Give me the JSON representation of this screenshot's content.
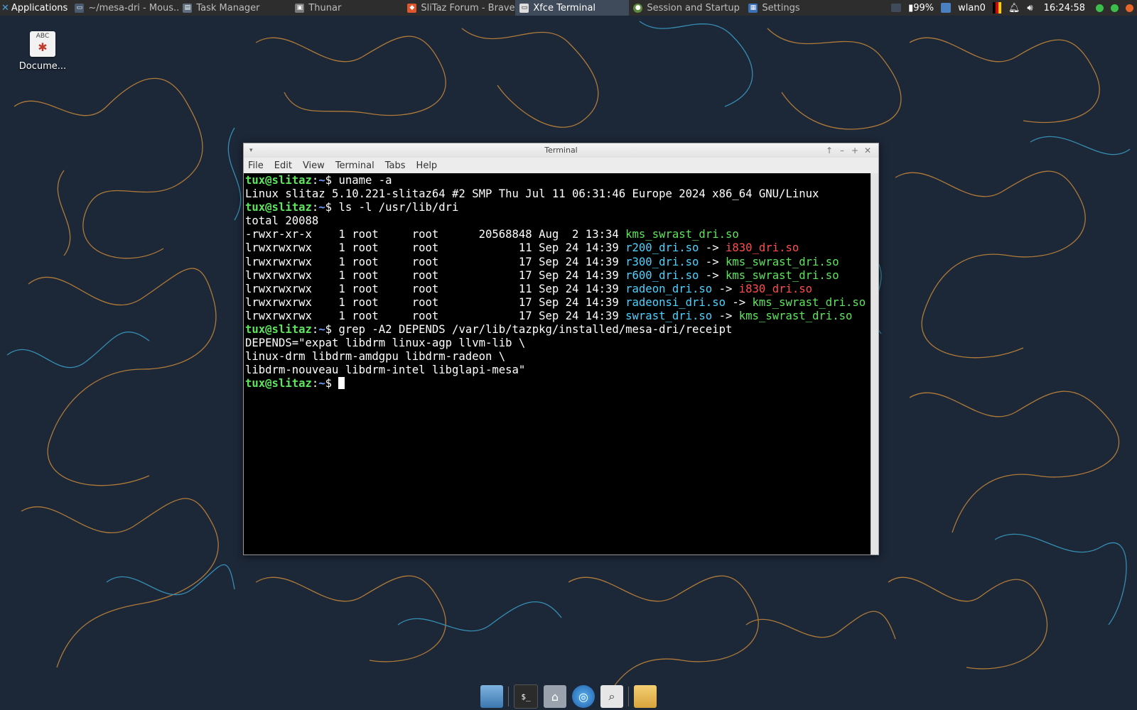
{
  "colors": {
    "panel_bg": "#2d2d2d",
    "terminal_bg": "#000000",
    "prompt_user": "#5ce65c",
    "prompt_dir": "#6b9bff",
    "exec_file": "#5ce65c",
    "symlink": "#4dd2ff",
    "broken_link": "#ff4d4d"
  },
  "top_panel": {
    "applications_label": "Applications",
    "tasks": [
      {
        "label": "~/mesa-dri - Mous...",
        "icon": "terminal-icon",
        "active": false
      },
      {
        "label": "Task Manager",
        "icon": "task-manager-icon",
        "active": false
      },
      {
        "label": "Thunar",
        "icon": "thunar-icon",
        "active": false
      },
      {
        "label": "SliTaz Forum - Brave",
        "icon": "brave-icon",
        "active": false
      },
      {
        "label": "Xfce Terminal",
        "icon": "xfce-terminal-icon",
        "active": true
      },
      {
        "label": "Session and Startup",
        "icon": "session-icon",
        "active": false
      },
      {
        "label": "Settings",
        "icon": "settings-icon",
        "active": false
      }
    ],
    "tray": {
      "battery": "99%",
      "network": "wlan0",
      "clock": "16:24:58"
    }
  },
  "desktop_icon": {
    "label": "Docume..."
  },
  "terminal": {
    "window_title": "Terminal",
    "menu": [
      "File",
      "Edit",
      "View",
      "Terminal",
      "Tabs",
      "Help"
    ],
    "prompt": {
      "user_host": "tux@slitaz",
      "colon": ":",
      "dir": "~",
      "symbol": "$ "
    },
    "lines": [
      {
        "type": "cmd",
        "text": "uname -a"
      },
      {
        "type": "out",
        "text": "Linux slitaz 5.10.221-slitaz64 #2 SMP Thu Jul 11 06:31:46 Europe 2024 x86_64 GNU/Linux"
      },
      {
        "type": "cmd",
        "text": "ls -l /usr/lib/dri"
      },
      {
        "type": "out",
        "text": "total 20088"
      },
      {
        "type": "ls",
        "meta": "-rwxr-xr-x    1 root     root      20568848 Aug  2 13:34 ",
        "name": "kms_swrast_dri.so",
        "name_color": "green",
        "target": "",
        "target_color": ""
      },
      {
        "type": "ls",
        "meta": "lrwxrwxrwx    1 root     root            11 Sep 24 14:39 ",
        "name": "r200_dri.so",
        "name_color": "cyan",
        "arrow": " -> ",
        "target": "i830_dri.so",
        "target_color": "red"
      },
      {
        "type": "ls",
        "meta": "lrwxrwxrwx    1 root     root            17 Sep 24 14:39 ",
        "name": "r300_dri.so",
        "name_color": "cyan",
        "arrow": " -> ",
        "target": "kms_swrast_dri.so",
        "target_color": "green"
      },
      {
        "type": "ls",
        "meta": "lrwxrwxrwx    1 root     root            17 Sep 24 14:39 ",
        "name": "r600_dri.so",
        "name_color": "cyan",
        "arrow": " -> ",
        "target": "kms_swrast_dri.so",
        "target_color": "green"
      },
      {
        "type": "ls",
        "meta": "lrwxrwxrwx    1 root     root            11 Sep 24 14:39 ",
        "name": "radeon_dri.so",
        "name_color": "cyan",
        "arrow": " -> ",
        "target": "i830_dri.so",
        "target_color": "red"
      },
      {
        "type": "ls",
        "meta": "lrwxrwxrwx    1 root     root            17 Sep 24 14:39 ",
        "name": "radeonsi_dri.so",
        "name_color": "cyan",
        "arrow": " -> ",
        "target": "kms_swrast_dri.so",
        "target_color": "green"
      },
      {
        "type": "ls",
        "meta": "lrwxrwxrwx    1 root     root            17 Sep 24 14:39 ",
        "name": "swrast_dri.so",
        "name_color": "cyan",
        "arrow": " -> ",
        "target": "kms_swrast_dri.so",
        "target_color": "green"
      },
      {
        "type": "cmd",
        "text": "grep -A2 DEPENDS /var/lib/tazpkg/installed/mesa-dri/receipt"
      },
      {
        "type": "out",
        "text": "DEPENDS=\"expat libdrm linux-agp llvm-lib \\"
      },
      {
        "type": "out",
        "text": "linux-drm libdrm-amdgpu libdrm-radeon \\"
      },
      {
        "type": "out",
        "text": "libdrm-nouveau libdrm-intel libglapi-mesa\""
      },
      {
        "type": "prompt_cursor",
        "text": ""
      }
    ]
  },
  "dock": [
    {
      "icon": "show-desktop-icon"
    },
    {
      "icon": "terminal-icon"
    },
    {
      "icon": "home-folder-icon"
    },
    {
      "icon": "web-browser-icon"
    },
    {
      "icon": "search-icon"
    },
    {
      "icon": "file-manager-icon"
    }
  ]
}
